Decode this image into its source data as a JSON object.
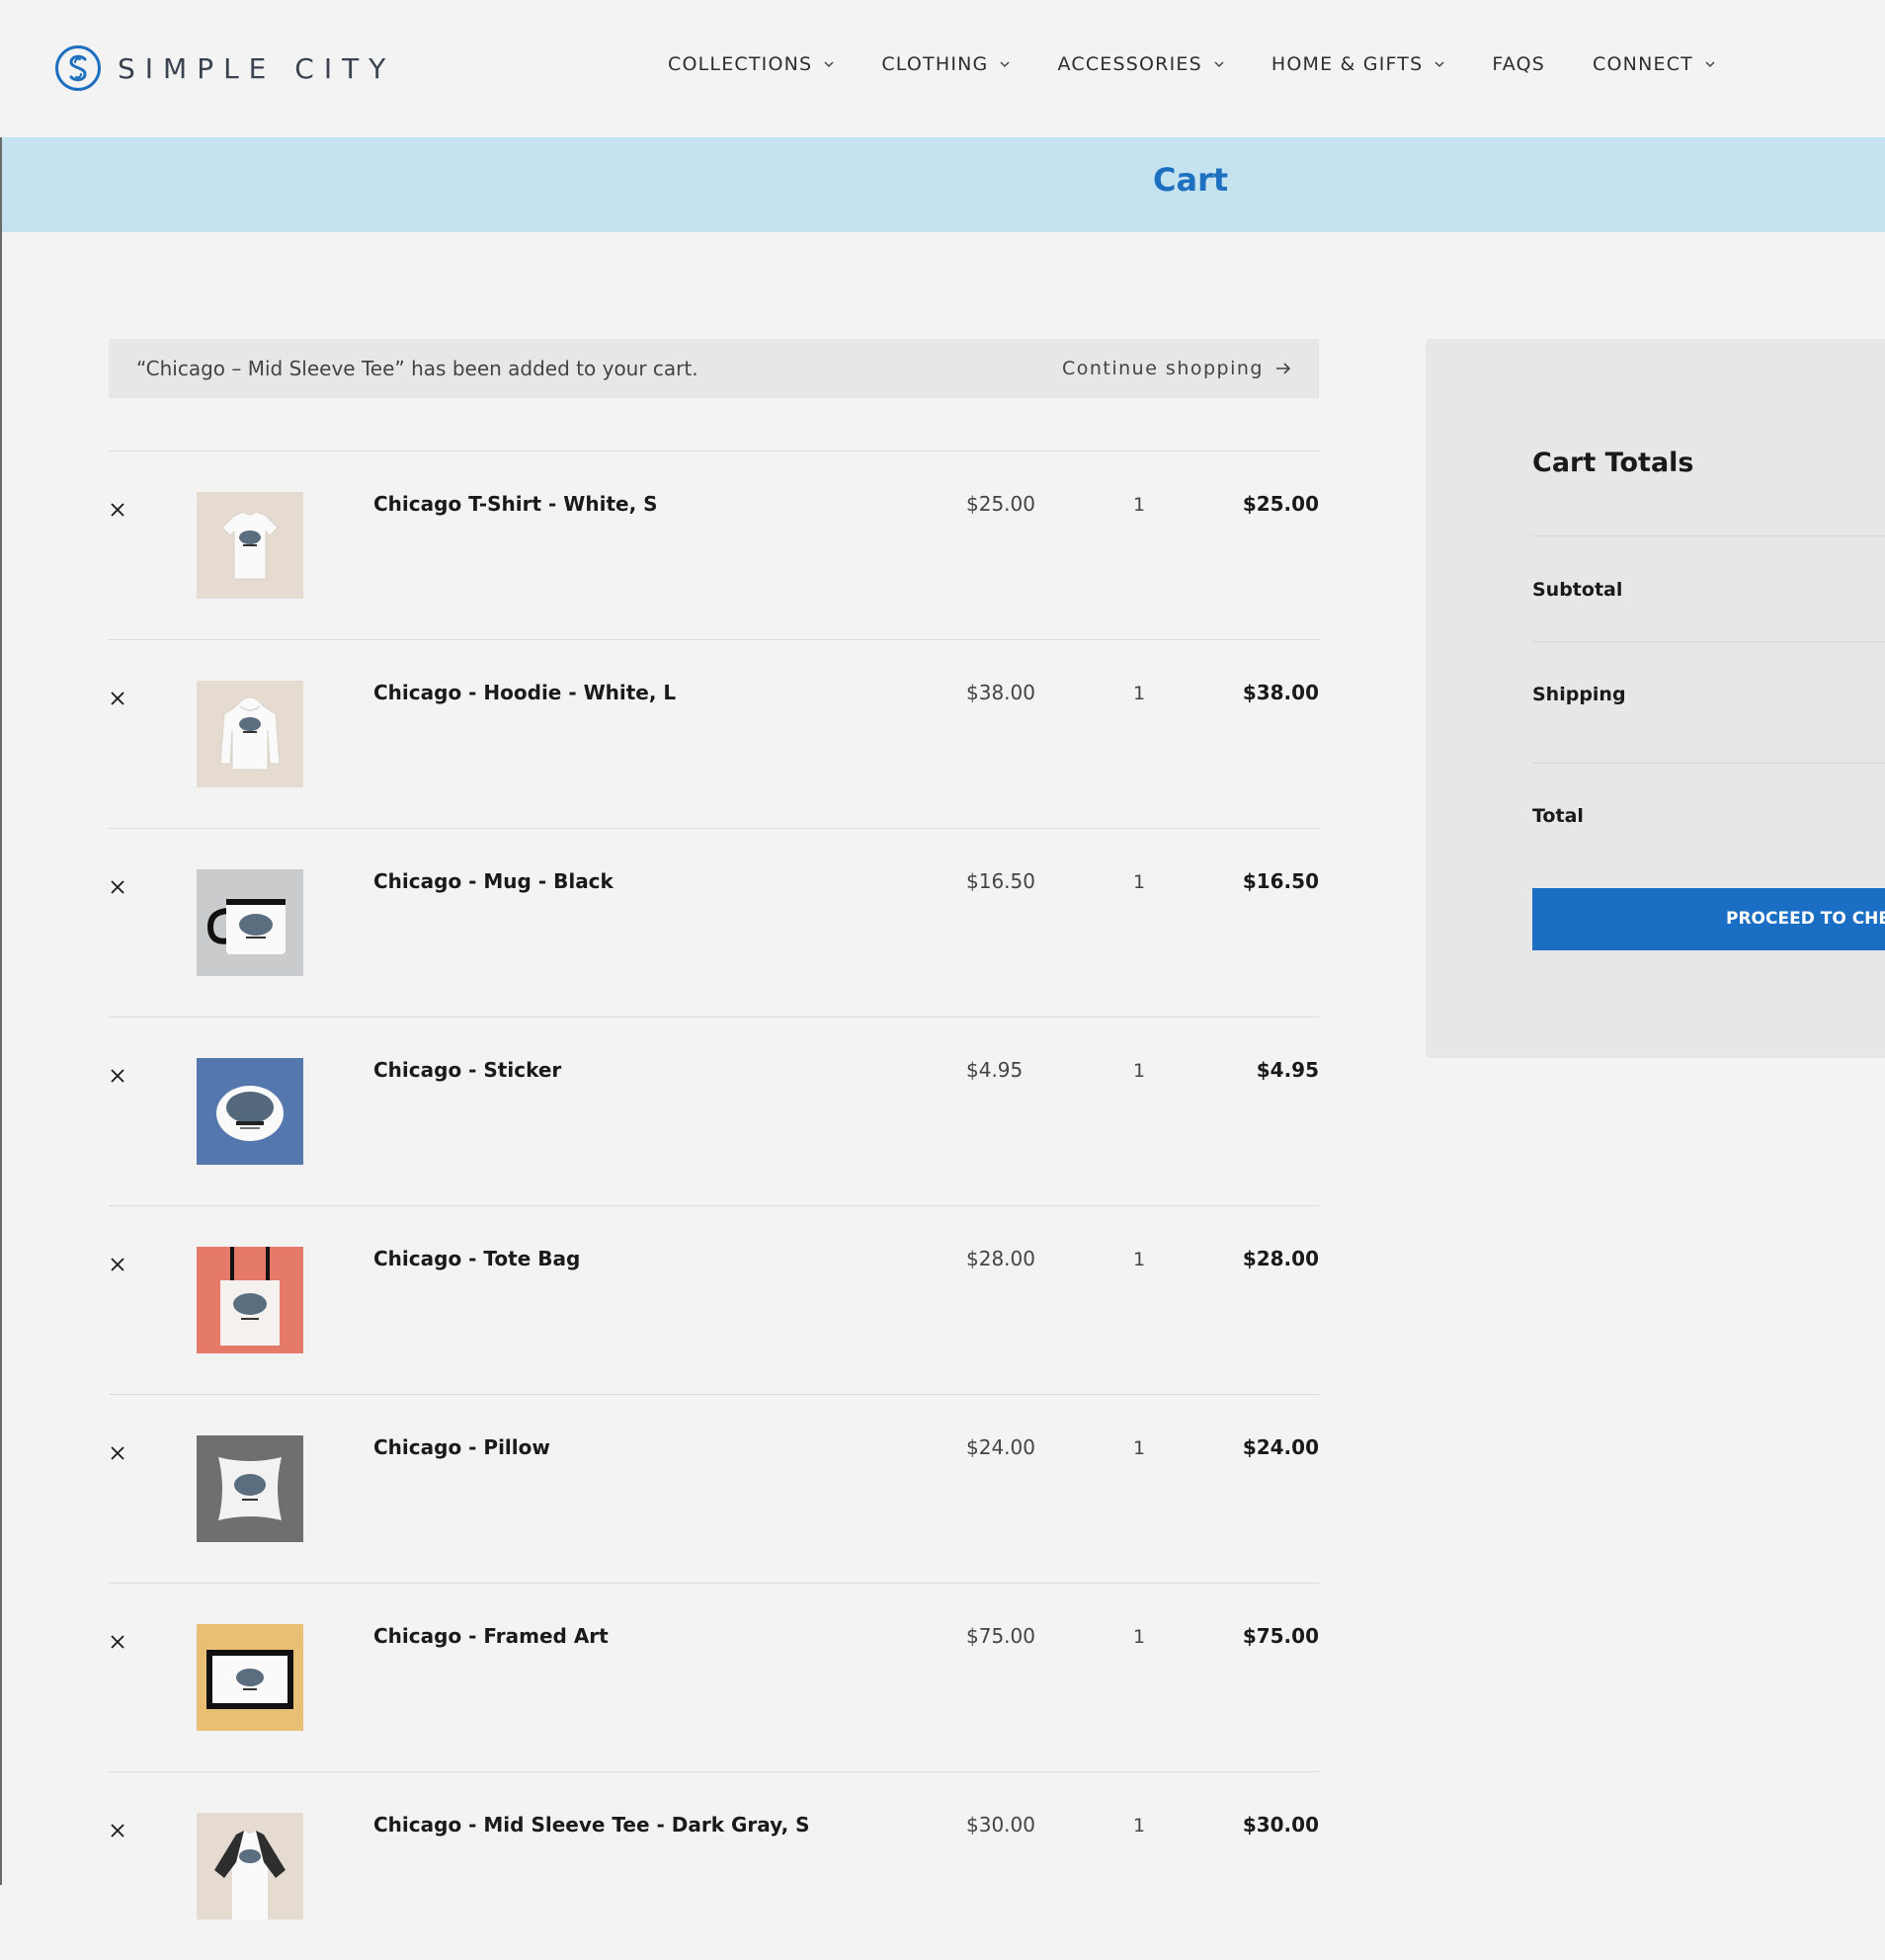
{
  "brand": {
    "name": "SIMPLE CITY"
  },
  "nav": {
    "items": [
      {
        "label": "COLLECTIONS",
        "has_dropdown": true
      },
      {
        "label": "CLOTHING",
        "has_dropdown": true
      },
      {
        "label": "ACCESSORIES",
        "has_dropdown": true
      },
      {
        "label": "HOME & GIFTS",
        "has_dropdown": true
      },
      {
        "label": "FAQS",
        "has_dropdown": false
      },
      {
        "label": "CONNECT",
        "has_dropdown": true
      }
    ]
  },
  "banner": {
    "title": "Cart"
  },
  "notice": {
    "message": "“Chicago – Mid Sleeve Tee” has been added to your cart.",
    "link_label": "Continue shopping"
  },
  "cart": {
    "items": [
      {
        "name": "Chicago T-Shirt - White, S",
        "price": "$25.00",
        "quantity": "1",
        "subtotal": "$25.00",
        "thumb_bg": "#e5dbd0",
        "thumb_icon": "tshirt-icon"
      },
      {
        "name": "Chicago - Hoodie - White, L",
        "price": "$38.00",
        "quantity": "1",
        "subtotal": "$38.00",
        "thumb_bg": "#e5dbd0",
        "thumb_icon": "hoodie-icon"
      },
      {
        "name": "Chicago - Mug - Black",
        "price": "$16.50",
        "quantity": "1",
        "subtotal": "$16.50",
        "thumb_bg": "#c9cbcd",
        "thumb_icon": "mug-icon"
      },
      {
        "name": "Chicago - Sticker",
        "price": "$4.95",
        "quantity": "1",
        "subtotal": "$4.95",
        "thumb_bg": "#5478ae",
        "thumb_icon": "sticker-icon"
      },
      {
        "name": "Chicago - Tote Bag",
        "price": "$28.00",
        "quantity": "1",
        "subtotal": "$28.00",
        "thumb_bg": "#e5796a",
        "thumb_icon": "tote-bag-icon"
      },
      {
        "name": "Chicago - Pillow",
        "price": "$24.00",
        "quantity": "1",
        "subtotal": "$24.00",
        "thumb_bg": "#6f6f6f",
        "thumb_icon": "pillow-icon"
      },
      {
        "name": "Chicago - Framed Art",
        "price": "$75.00",
        "quantity": "1",
        "subtotal": "$75.00",
        "thumb_bg": "#e8bf73",
        "thumb_icon": "framed-art-icon"
      },
      {
        "name": "Chicago - Mid Sleeve Tee - Dark Gray, S",
        "price": "$30.00",
        "quantity": "1",
        "subtotal": "$30.00",
        "thumb_bg": "#e5dbd0",
        "thumb_icon": "raglan-tee-icon"
      }
    ]
  },
  "totals": {
    "title": "Cart Totals",
    "subtotal_label": "Subtotal",
    "shipping_label": "Shipping",
    "total_label": "Total",
    "checkout_label": "PROCEED TO CHECKOUT"
  },
  "colors": {
    "accent": "#1a6fc4",
    "banner_bg": "#c5e2f0",
    "banner_text": "#1d6fbf",
    "page_bg": "#f3f3f3",
    "panel_bg": "#e7e7e7"
  }
}
